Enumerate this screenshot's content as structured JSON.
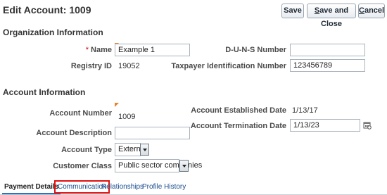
{
  "header": {
    "title": "Edit Account: 1009",
    "buttons": {
      "save": "Save",
      "save_and_close_u": "S",
      "save_and_close_rest": "ave and Close",
      "cancel_u": "C",
      "cancel_rest": "ancel"
    }
  },
  "org": {
    "section_title": "Organization Information",
    "required_marker": "*",
    "name_label": "Name",
    "name_value": "Example 1",
    "registry_label": "Registry ID",
    "registry_value": "19052",
    "duns_label": "D-U-N-S Number",
    "duns_value": "",
    "taxpayer_label": "Taxpayer Identification Number",
    "taxpayer_value": "123456789"
  },
  "account": {
    "section_title": "Account Information",
    "number_label": "Account Number",
    "number_value": "1009",
    "description_label": "Account Description",
    "description_value": "",
    "type_label": "Account Type",
    "type_value": "External",
    "class_label": "Customer Class",
    "class_value": "Public sector companies",
    "established_label": "Account Established Date",
    "established_value": "1/13/17",
    "termination_label": "Account Termination Date",
    "termination_value": "1/13/23"
  },
  "tabs": [
    {
      "label": "Payment Details",
      "state": "active"
    },
    {
      "label": "Communication",
      "state": "highlighted"
    },
    {
      "label": "Relationships",
      "state": "normal"
    },
    {
      "label": "Profile History",
      "state": "normal"
    }
  ],
  "colors": {
    "link": "#1a4d8f",
    "required": "#cc0000",
    "highlight_border": "#e01010",
    "change_flag": "#e8822a"
  },
  "icons": {
    "termination_date_picker": "calendar-icon",
    "dropdown": "chevron-down-icon"
  }
}
